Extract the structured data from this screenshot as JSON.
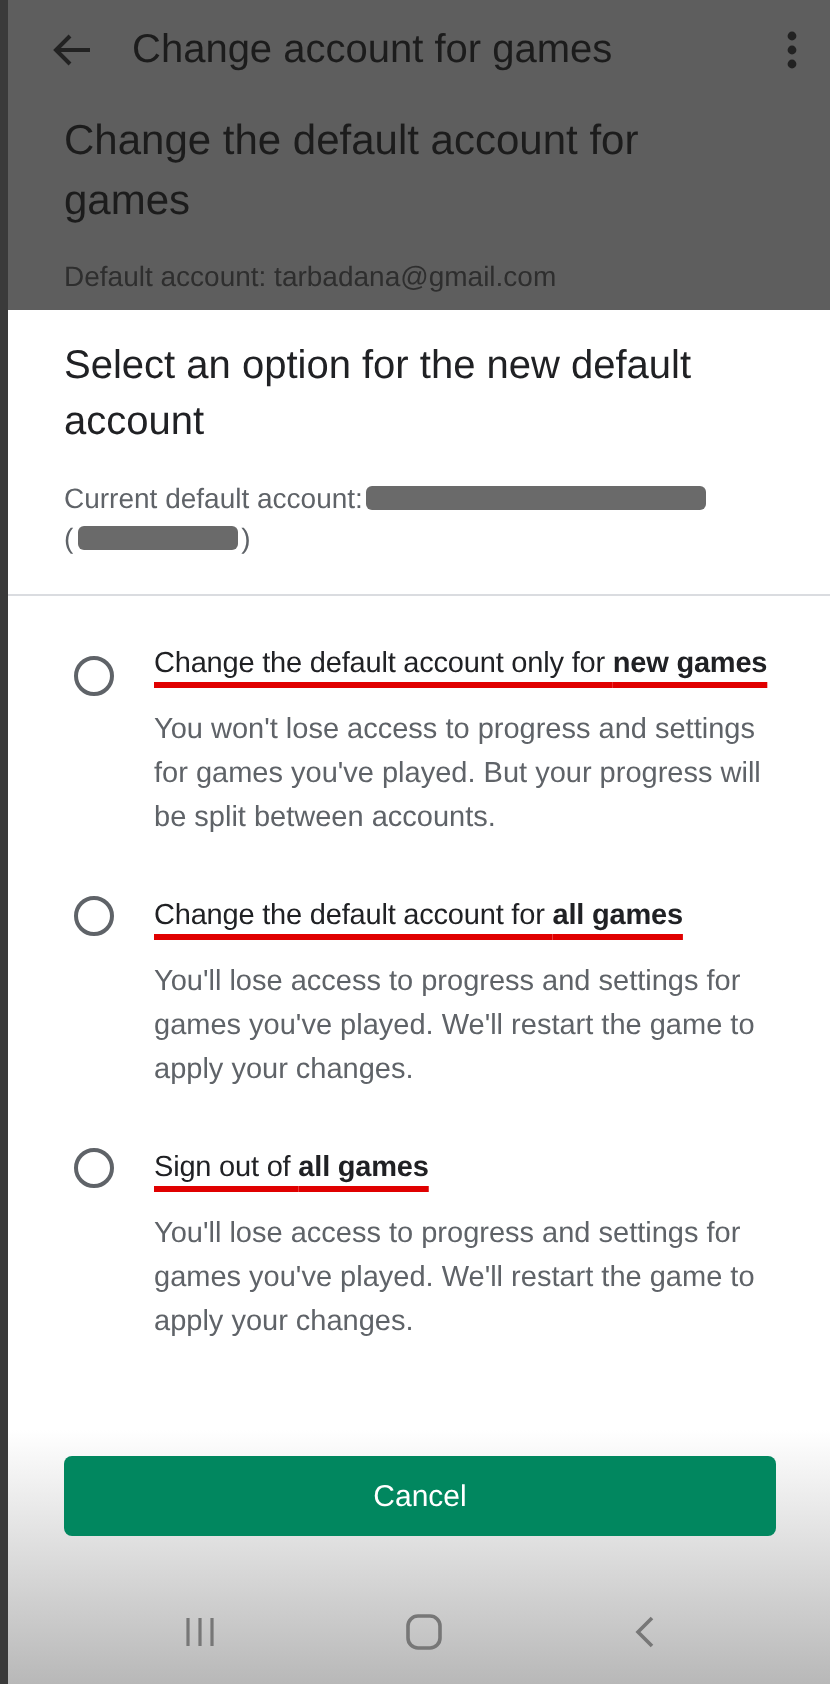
{
  "app_bar": {
    "back_icon": true,
    "title": "Change account for games",
    "menu_icon": true
  },
  "background_page": {
    "heading": "Change the default account for games",
    "default_account": "Default account: tarbadana@gmail.com"
  },
  "dialog": {
    "title": "Select an option for the new default account",
    "current_account": {
      "label": "Current default account:",
      "open": "(",
      "close": ")",
      "redacted": true
    },
    "options": [
      {
        "title": "Change the default account only for **new games**",
        "description": "You won't lose access to progress and settings for games you've played. But your progress will be split between accounts.",
        "selected": false,
        "annotated": true
      },
      {
        "title": "Change the default account for **all games**",
        "description": "You'll lose access to progress and settings for games you've played. We'll restart the game to apply your changes.",
        "selected": false,
        "annotated": true
      },
      {
        "title": "Sign out of **all games**",
        "description": "You'll lose access to progress and settings for games you've played. We'll restart the game to apply your changes.",
        "selected": false,
        "annotated": true
      }
    ],
    "cancel_button": "Cancel"
  },
  "nav_bar": {
    "buttons": [
      {
        "kind": "recents"
      },
      {
        "kind": "home"
      },
      {
        "kind": "back"
      }
    ]
  }
}
